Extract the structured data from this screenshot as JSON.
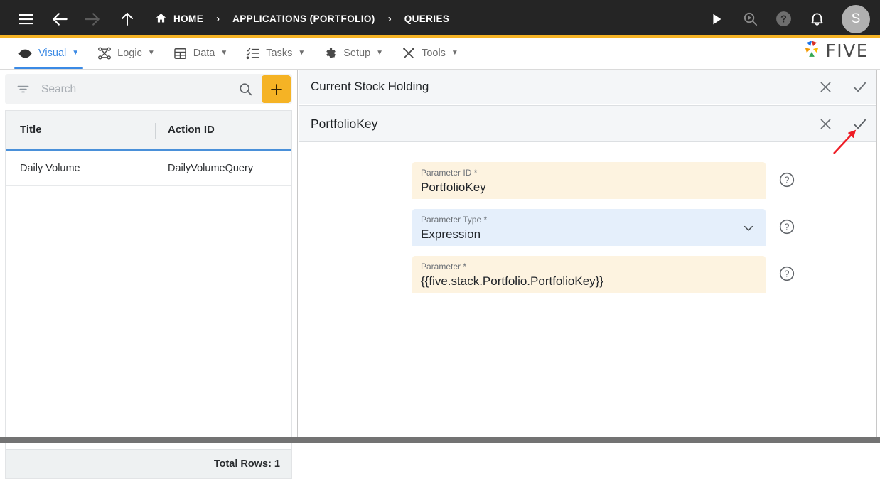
{
  "topbar": {
    "icons": {
      "menu": "hamburger-icon",
      "back": "arrow-left-icon",
      "forward": "arrow-right-icon",
      "up": "arrow-up-icon",
      "run": "play-icon",
      "search": "search-query-icon",
      "help": "help-circle-icon",
      "notifications": "bell-icon"
    },
    "breadcrumb": [
      {
        "label": "HOME",
        "icon": "home-icon"
      },
      {
        "label": "APPLICATIONS (PORTFOLIO)",
        "icon": ""
      },
      {
        "label": "QUERIES",
        "icon": ""
      }
    ],
    "separator": "›",
    "avatar_initial": "S",
    "accent_color": "#f5b325",
    "background_color": "#252525"
  },
  "menubar": {
    "items": [
      {
        "label": "Visual",
        "icon": "eye-icon",
        "caret": "▼",
        "active": true
      },
      {
        "label": "Logic",
        "icon": "logic-nodes-icon",
        "caret": "▼",
        "active": false
      },
      {
        "label": "Data",
        "icon": "table-grid-icon",
        "caret": "▼",
        "active": false
      },
      {
        "label": "Tasks",
        "icon": "checklist-icon",
        "caret": "▼",
        "active": false
      },
      {
        "label": "Setup",
        "icon": "gear-icon",
        "caret": "▼",
        "active": false
      },
      {
        "label": "Tools",
        "icon": "tools-icon",
        "caret": "▼",
        "active": false
      }
    ],
    "active_color": "#3b8ae5",
    "brand": {
      "text": "FIVE",
      "logo": "five-pinwheel-logo"
    }
  },
  "sidebar": {
    "search": {
      "placeholder": "Search",
      "value": "",
      "filter_icon": "filter-icon",
      "search_icon": "search-icon"
    },
    "add_button": {
      "label": "+",
      "icon": "plus-icon",
      "color": "#f5b325"
    },
    "grid": {
      "columns": [
        "Title",
        "Action ID"
      ],
      "rows": [
        {
          "title": "Daily Volume",
          "action_id": "DailyVolumeQuery"
        }
      ]
    },
    "footer": {
      "total_rows_label": "Total Rows: 1"
    }
  },
  "detail": {
    "outer_panel": {
      "title": "Current Stock Holding",
      "close_icon": "close-x-icon",
      "confirm_icon": "check-tick-icon"
    },
    "inner_panel": {
      "title": "PortfolioKey",
      "close_icon": "close-x-icon",
      "confirm_icon": "check-tick-icon"
    },
    "fields": [
      {
        "label": "Parameter ID *",
        "value": "PortfolioKey",
        "style": "tan",
        "control": "text",
        "help_icon": "help-circle-icon"
      },
      {
        "label": "Parameter Type *",
        "value": "Expression",
        "style": "blue",
        "control": "select",
        "caret_icon": "chevron-down-icon",
        "help_icon": "help-circle-icon"
      },
      {
        "label": "Parameter *",
        "value": "{{five.stack.Portfolio.PortfolioKey}}",
        "style": "tan",
        "control": "text",
        "help_icon": "help-circle-icon"
      }
    ]
  },
  "annotation": {
    "arrow": {
      "color": "#ee1c25",
      "points_to": "inner-panel-confirm-button"
    }
  }
}
